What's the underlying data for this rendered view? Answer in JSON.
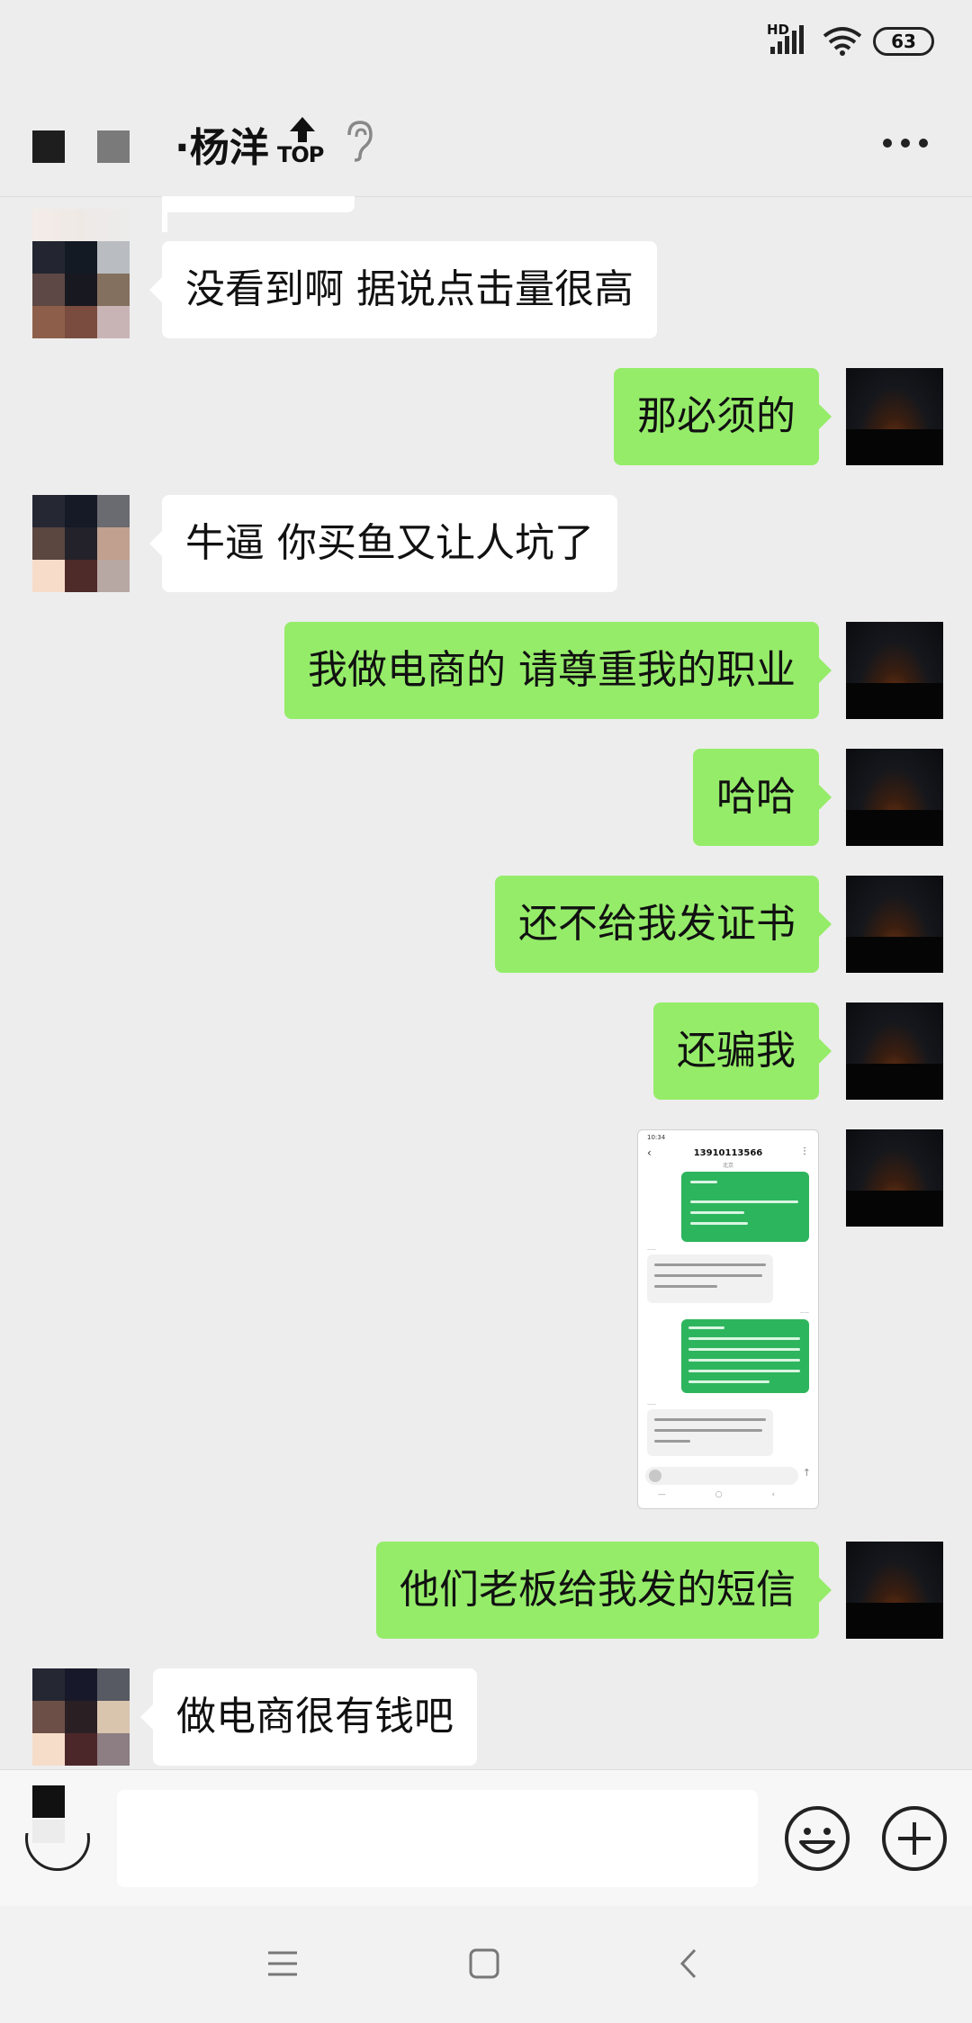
{
  "status_bar": {
    "network": "HD",
    "battery": "63",
    "icons": [
      "signal-icon",
      "wifi-icon",
      "battery-icon"
    ]
  },
  "header": {
    "title": "·杨洋",
    "top_badge": "TOP",
    "icons": [
      "arrow-up-icon",
      "ear-icon",
      "more-icon"
    ]
  },
  "messages": [
    {
      "side": "in",
      "text": "没看到啊 据说点击量很高"
    },
    {
      "side": "out",
      "text": "那必须的"
    },
    {
      "side": "in",
      "text": "牛逼 你买鱼又让人坑了"
    },
    {
      "side": "out",
      "text": "我做电商的 请尊重我的职业"
    },
    {
      "side": "out",
      "text": "哈哈"
    },
    {
      "side": "out",
      "text": "还不给我发证书"
    },
    {
      "side": "out",
      "text": "还骗我"
    },
    {
      "side": "out",
      "type": "image",
      "image": {
        "time": "10:34",
        "number": "13910113566",
        "subtitle": "北京"
      }
    },
    {
      "side": "out",
      "text": "他们老板给我发的短信"
    },
    {
      "side": "in",
      "text": "做电商很有钱吧"
    }
  ],
  "input_bar": {
    "placeholder": "",
    "icons": [
      "voice-icon",
      "emoji-icon",
      "plus-icon"
    ]
  },
  "nav_bar": {
    "icons": [
      "menu-icon",
      "home-icon",
      "back-icon"
    ]
  },
  "colors": {
    "background": "#ededed",
    "outgoing_bubble": "#95ec69",
    "incoming_bubble": "#ffffff",
    "sms_bubble": "#2db55d"
  }
}
